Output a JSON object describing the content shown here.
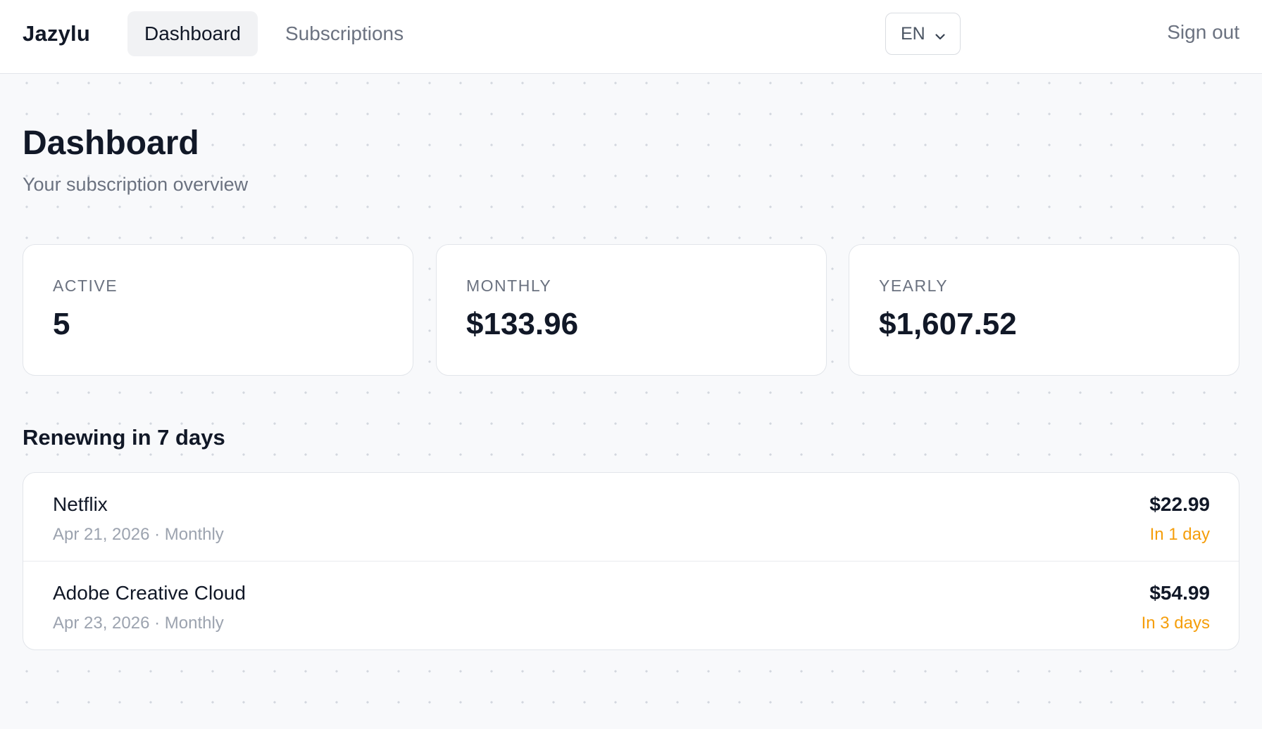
{
  "header": {
    "brand": "Jazylu",
    "tabs": [
      {
        "label": "Dashboard",
        "active": true
      },
      {
        "label": "Subscriptions",
        "active": false
      }
    ],
    "language": {
      "selected": "EN",
      "icon": "chevron-down-icon"
    },
    "signout_label": "Sign out"
  },
  "page": {
    "title": "Dashboard",
    "subtitle": "Your subscription overview"
  },
  "stats": [
    {
      "label": "ACTIVE",
      "value": "5"
    },
    {
      "label": "MONTHLY",
      "value": "$133.96"
    },
    {
      "label": "YEARLY",
      "value": "$1,607.52"
    }
  ],
  "renewals": {
    "title": "Renewing in 7 days",
    "items": [
      {
        "name": "Netflix",
        "meta": "Apr 21, 2026 · Monthly",
        "price": "$22.99",
        "due": "In 1 day"
      },
      {
        "name": "Adobe Creative Cloud",
        "meta": "Apr 23, 2026 · Monthly",
        "price": "$54.99",
        "due": "In 3 days"
      }
    ]
  },
  "colors": {
    "background": "#f8f9fb",
    "text": "#111827",
    "muted": "#6b7280",
    "due_accent": "#f59e0b"
  }
}
